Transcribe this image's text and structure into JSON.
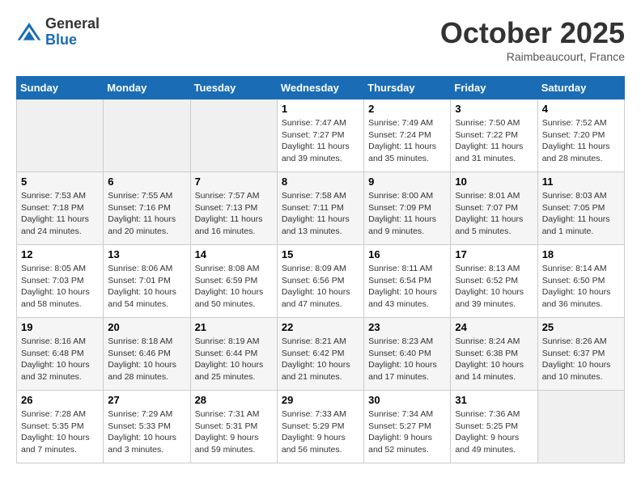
{
  "header": {
    "logo_general": "General",
    "logo_blue": "Blue",
    "month": "October 2025",
    "location": "Raimbeaucourt, France"
  },
  "weekdays": [
    "Sunday",
    "Monday",
    "Tuesday",
    "Wednesday",
    "Thursday",
    "Friday",
    "Saturday"
  ],
  "weeks": [
    [
      {
        "day": "",
        "text": ""
      },
      {
        "day": "",
        "text": ""
      },
      {
        "day": "",
        "text": ""
      },
      {
        "day": "1",
        "text": "Sunrise: 7:47 AM\nSunset: 7:27 PM\nDaylight: 11 hours\nand 39 minutes."
      },
      {
        "day": "2",
        "text": "Sunrise: 7:49 AM\nSunset: 7:24 PM\nDaylight: 11 hours\nand 35 minutes."
      },
      {
        "day": "3",
        "text": "Sunrise: 7:50 AM\nSunset: 7:22 PM\nDaylight: 11 hours\nand 31 minutes."
      },
      {
        "day": "4",
        "text": "Sunrise: 7:52 AM\nSunset: 7:20 PM\nDaylight: 11 hours\nand 28 minutes."
      }
    ],
    [
      {
        "day": "5",
        "text": "Sunrise: 7:53 AM\nSunset: 7:18 PM\nDaylight: 11 hours\nand 24 minutes."
      },
      {
        "day": "6",
        "text": "Sunrise: 7:55 AM\nSunset: 7:16 PM\nDaylight: 11 hours\nand 20 minutes."
      },
      {
        "day": "7",
        "text": "Sunrise: 7:57 AM\nSunset: 7:13 PM\nDaylight: 11 hours\nand 16 minutes."
      },
      {
        "day": "8",
        "text": "Sunrise: 7:58 AM\nSunset: 7:11 PM\nDaylight: 11 hours\nand 13 minutes."
      },
      {
        "day": "9",
        "text": "Sunrise: 8:00 AM\nSunset: 7:09 PM\nDaylight: 11 hours\nand 9 minutes."
      },
      {
        "day": "10",
        "text": "Sunrise: 8:01 AM\nSunset: 7:07 PM\nDaylight: 11 hours\nand 5 minutes."
      },
      {
        "day": "11",
        "text": "Sunrise: 8:03 AM\nSunset: 7:05 PM\nDaylight: 11 hours\nand 1 minute."
      }
    ],
    [
      {
        "day": "12",
        "text": "Sunrise: 8:05 AM\nSunset: 7:03 PM\nDaylight: 10 hours\nand 58 minutes."
      },
      {
        "day": "13",
        "text": "Sunrise: 8:06 AM\nSunset: 7:01 PM\nDaylight: 10 hours\nand 54 minutes."
      },
      {
        "day": "14",
        "text": "Sunrise: 8:08 AM\nSunset: 6:59 PM\nDaylight: 10 hours\nand 50 minutes."
      },
      {
        "day": "15",
        "text": "Sunrise: 8:09 AM\nSunset: 6:56 PM\nDaylight: 10 hours\nand 47 minutes."
      },
      {
        "day": "16",
        "text": "Sunrise: 8:11 AM\nSunset: 6:54 PM\nDaylight: 10 hours\nand 43 minutes."
      },
      {
        "day": "17",
        "text": "Sunrise: 8:13 AM\nSunset: 6:52 PM\nDaylight: 10 hours\nand 39 minutes."
      },
      {
        "day": "18",
        "text": "Sunrise: 8:14 AM\nSunset: 6:50 PM\nDaylight: 10 hours\nand 36 minutes."
      }
    ],
    [
      {
        "day": "19",
        "text": "Sunrise: 8:16 AM\nSunset: 6:48 PM\nDaylight: 10 hours\nand 32 minutes."
      },
      {
        "day": "20",
        "text": "Sunrise: 8:18 AM\nSunset: 6:46 PM\nDaylight: 10 hours\nand 28 minutes."
      },
      {
        "day": "21",
        "text": "Sunrise: 8:19 AM\nSunset: 6:44 PM\nDaylight: 10 hours\nand 25 minutes."
      },
      {
        "day": "22",
        "text": "Sunrise: 8:21 AM\nSunset: 6:42 PM\nDaylight: 10 hours\nand 21 minutes."
      },
      {
        "day": "23",
        "text": "Sunrise: 8:23 AM\nSunset: 6:40 PM\nDaylight: 10 hours\nand 17 minutes."
      },
      {
        "day": "24",
        "text": "Sunrise: 8:24 AM\nSunset: 6:38 PM\nDaylight: 10 hours\nand 14 minutes."
      },
      {
        "day": "25",
        "text": "Sunrise: 8:26 AM\nSunset: 6:37 PM\nDaylight: 10 hours\nand 10 minutes."
      }
    ],
    [
      {
        "day": "26",
        "text": "Sunrise: 7:28 AM\nSunset: 5:35 PM\nDaylight: 10 hours\nand 7 minutes."
      },
      {
        "day": "27",
        "text": "Sunrise: 7:29 AM\nSunset: 5:33 PM\nDaylight: 10 hours\nand 3 minutes."
      },
      {
        "day": "28",
        "text": "Sunrise: 7:31 AM\nSunset: 5:31 PM\nDaylight: 9 hours\nand 59 minutes."
      },
      {
        "day": "29",
        "text": "Sunrise: 7:33 AM\nSunset: 5:29 PM\nDaylight: 9 hours\nand 56 minutes."
      },
      {
        "day": "30",
        "text": "Sunrise: 7:34 AM\nSunset: 5:27 PM\nDaylight: 9 hours\nand 52 minutes."
      },
      {
        "day": "31",
        "text": "Sunrise: 7:36 AM\nSunset: 5:25 PM\nDaylight: 9 hours\nand 49 minutes."
      },
      {
        "day": "",
        "text": ""
      }
    ]
  ]
}
